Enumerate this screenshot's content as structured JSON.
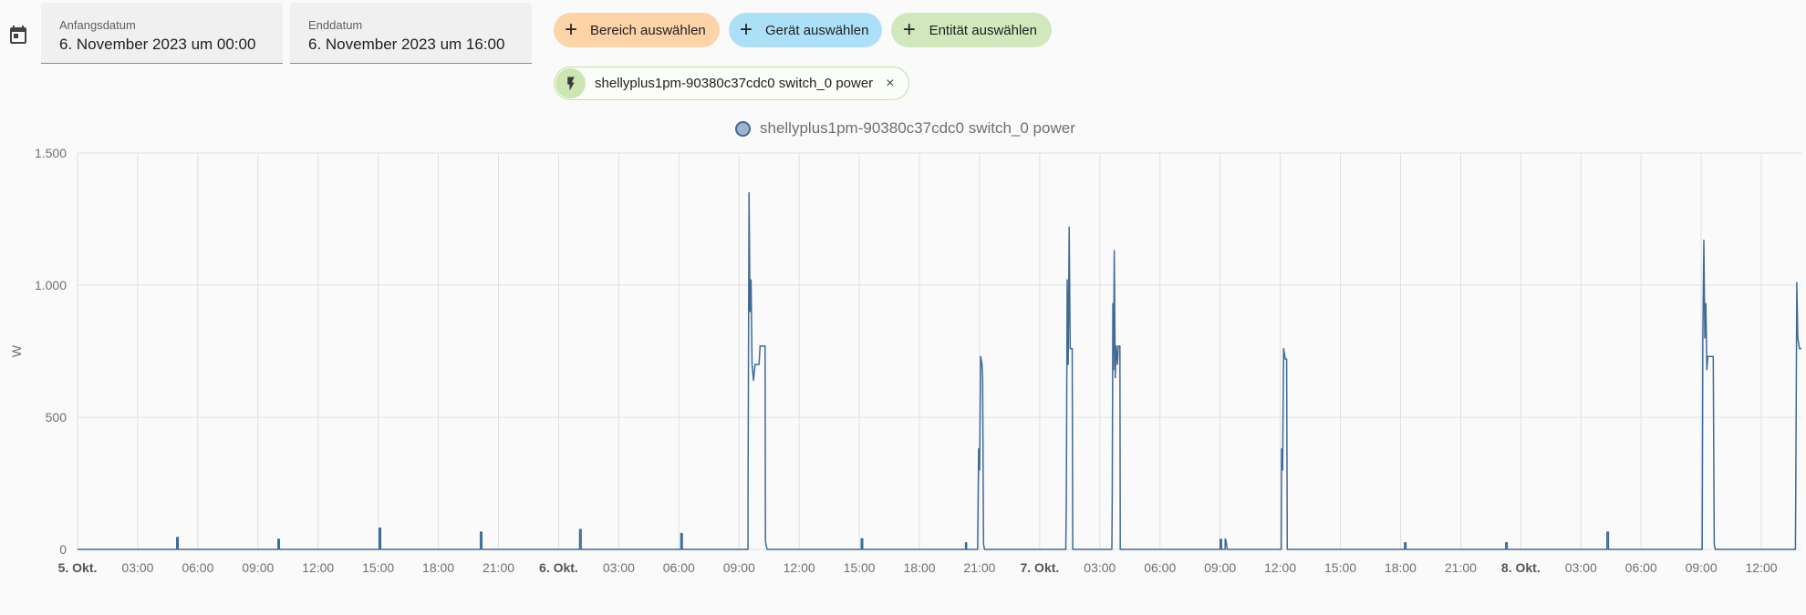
{
  "header": {
    "start": {
      "label": "Anfangsdatum",
      "value": "6. November 2023 um 00:00"
    },
    "end": {
      "label": "Enddatum",
      "value": "6. November 2023 um 16:00"
    }
  },
  "targets": {
    "area_label": "Bereich auswählen",
    "device_label": "Gerät auswählen",
    "entity_label": "Entität auswählen",
    "plus": "+"
  },
  "selected_entity": {
    "name": "shellyplus1pm-90380c37cdc0 switch_0 power",
    "close": "×"
  },
  "colors": {
    "series": "#3f6a96",
    "area_chip": "#fdd3a8",
    "device_chip": "#ace0f7",
    "entity_chip": "#d2e8bc"
  },
  "icons": {
    "calendar": "calendar-icon",
    "plus": "plus-icon",
    "bolt": "flash-icon",
    "close": "close-icon"
  },
  "chart_data": {
    "type": "line",
    "title": "",
    "xlabel": "",
    "ylabel": "W",
    "ylim": [
      0,
      1500
    ],
    "yticks": [
      0,
      500,
      1000,
      1500
    ],
    "ytick_labels": [
      "0",
      "500",
      "1.000",
      "1.500"
    ],
    "x_unit": "hours since 5. Okt. 00:00",
    "xlim": [
      0,
      86
    ],
    "x_tick_labels": [
      "5. Okt.",
      "03:00",
      "06:00",
      "09:00",
      "12:00",
      "15:00",
      "18:00",
      "21:00",
      "6. Okt.",
      "03:00",
      "06:00",
      "09:00",
      "12:00",
      "15:00",
      "18:00",
      "21:00",
      "7. Okt.",
      "03:00",
      "06:00",
      "09:00",
      "12:00",
      "15:00",
      "18:00",
      "21:00",
      "8. Okt.",
      "03:00",
      "06:00",
      "09:00",
      "12:00"
    ],
    "bold_ticks": [
      "5. Okt.",
      "6. Okt.",
      "7. Okt.",
      "8. Okt."
    ],
    "grid": true,
    "legend": "top",
    "series": [
      {
        "name": "shellyplus1pm-90380c37cdc0 switch_0 power",
        "points": [
          [
            0,
            0
          ],
          [
            4.95,
            0
          ],
          [
            4.95,
            45
          ],
          [
            5.02,
            45
          ],
          [
            5.02,
            0
          ],
          [
            10.0,
            0
          ],
          [
            10.0,
            38
          ],
          [
            10.07,
            38
          ],
          [
            10.07,
            0
          ],
          [
            15.05,
            0
          ],
          [
            15.05,
            80
          ],
          [
            15.12,
            80
          ],
          [
            15.12,
            0
          ],
          [
            20.1,
            0
          ],
          [
            20.1,
            65
          ],
          [
            20.17,
            65
          ],
          [
            20.17,
            0
          ],
          [
            25.05,
            0
          ],
          [
            25.05,
            75
          ],
          [
            25.12,
            75
          ],
          [
            25.12,
            0
          ],
          [
            30.1,
            0
          ],
          [
            30.1,
            60
          ],
          [
            30.17,
            60
          ],
          [
            30.17,
            0
          ],
          [
            33.45,
            0
          ],
          [
            33.45,
            200
          ],
          [
            33.5,
            1350
          ],
          [
            33.55,
            900
          ],
          [
            33.6,
            1020
          ],
          [
            33.65,
            700
          ],
          [
            33.72,
            640
          ],
          [
            33.8,
            700
          ],
          [
            34.0,
            700
          ],
          [
            34.05,
            770
          ],
          [
            34.3,
            770
          ],
          [
            34.32,
            30
          ],
          [
            34.4,
            0
          ],
          [
            39.1,
            0
          ],
          [
            39.1,
            40
          ],
          [
            39.17,
            40
          ],
          [
            39.17,
            0
          ],
          [
            44.3,
            0
          ],
          [
            44.3,
            25
          ],
          [
            44.35,
            25
          ],
          [
            44.35,
            0
          ],
          [
            44.9,
            0
          ],
          [
            44.95,
            380
          ],
          [
            45.0,
            300
          ],
          [
            45.05,
            730
          ],
          [
            45.12,
            700
          ],
          [
            45.15,
            650
          ],
          [
            45.2,
            20
          ],
          [
            45.25,
            0
          ],
          [
            49.3,
            0
          ],
          [
            49.33,
            200
          ],
          [
            49.37,
            1020
          ],
          [
            49.42,
            700
          ],
          [
            49.47,
            1220
          ],
          [
            49.52,
            760
          ],
          [
            49.62,
            760
          ],
          [
            49.65,
            0
          ],
          [
            51.6,
            0
          ],
          [
            51.62,
            200
          ],
          [
            51.65,
            930
          ],
          [
            51.68,
            680
          ],
          [
            51.72,
            1130
          ],
          [
            51.77,
            650
          ],
          [
            51.82,
            770
          ],
          [
            51.88,
            700
          ],
          [
            51.92,
            770
          ],
          [
            52.0,
            770
          ],
          [
            52.02,
            0
          ],
          [
            57.0,
            0
          ],
          [
            57.0,
            38
          ],
          [
            57.07,
            38
          ],
          [
            57.07,
            0
          ],
          [
            57.25,
            0
          ],
          [
            57.25,
            40
          ],
          [
            57.3,
            30
          ],
          [
            57.35,
            0
          ],
          [
            60.05,
            0
          ],
          [
            60.07,
            380
          ],
          [
            60.12,
            300
          ],
          [
            60.17,
            760
          ],
          [
            60.25,
            720
          ],
          [
            60.32,
            720
          ],
          [
            60.35,
            0
          ],
          [
            66.2,
            0
          ],
          [
            66.2,
            25
          ],
          [
            66.27,
            25
          ],
          [
            66.27,
            0
          ],
          [
            71.25,
            0
          ],
          [
            71.25,
            25
          ],
          [
            71.32,
            25
          ],
          [
            71.32,
            0
          ],
          [
            76.3,
            0
          ],
          [
            76.3,
            65
          ],
          [
            76.37,
            65
          ],
          [
            76.37,
            0
          ],
          [
            81.05,
            0
          ],
          [
            81.08,
            800
          ],
          [
            81.13,
            1170
          ],
          [
            81.18,
            800
          ],
          [
            81.23,
            930
          ],
          [
            81.28,
            680
          ],
          [
            81.33,
            730
          ],
          [
            81.6,
            730
          ],
          [
            81.65,
            20
          ],
          [
            81.7,
            0
          ],
          [
            85.7,
            0
          ],
          [
            85.72,
            220
          ],
          [
            85.77,
            1010
          ],
          [
            85.82,
            800
          ],
          [
            85.9,
            760
          ],
          [
            86.0,
            760
          ]
        ]
      }
    ]
  }
}
